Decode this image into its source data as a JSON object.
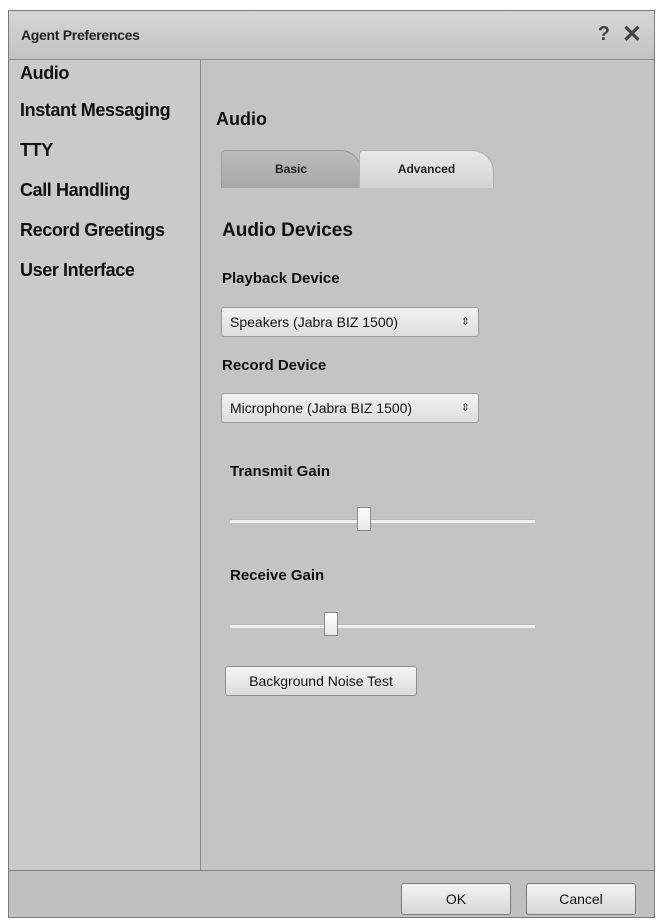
{
  "window": {
    "title": "Agent Preferences",
    "help_glyph": "?",
    "close_glyph": "✕"
  },
  "sidebar": {
    "items": [
      {
        "label": "Audio"
      },
      {
        "label": "Instant Messaging"
      },
      {
        "label": "TTY"
      },
      {
        "label": "Call Handling"
      },
      {
        "label": "Record Greetings"
      },
      {
        "label": "User Interface"
      }
    ]
  },
  "main": {
    "section_title": "Audio",
    "tabs": [
      {
        "label": "Basic"
      },
      {
        "label": "Advanced",
        "selected": true
      }
    ],
    "subheading": "Audio Devices",
    "playback": {
      "label": "Playback Device",
      "value": "Speakers (Jabra BIZ 1500)"
    },
    "record": {
      "label": "Record Device",
      "value": "Microphone (Jabra BIZ 1500)"
    },
    "transmit_gain": {
      "label": "Transmit Gain",
      "level": 0.44
    },
    "receive_gain": {
      "label": "Receive Gain",
      "level": 0.33
    },
    "noise_test_label": "Background Noise Test"
  },
  "footer": {
    "ok_label": "OK",
    "cancel_label": "Cancel"
  },
  "icons": {
    "select_arrow": "◆"
  },
  "colors": {
    "background": "#c4c4c4",
    "sidebar": "#cacaca",
    "selected_tab": "#dedede"
  }
}
